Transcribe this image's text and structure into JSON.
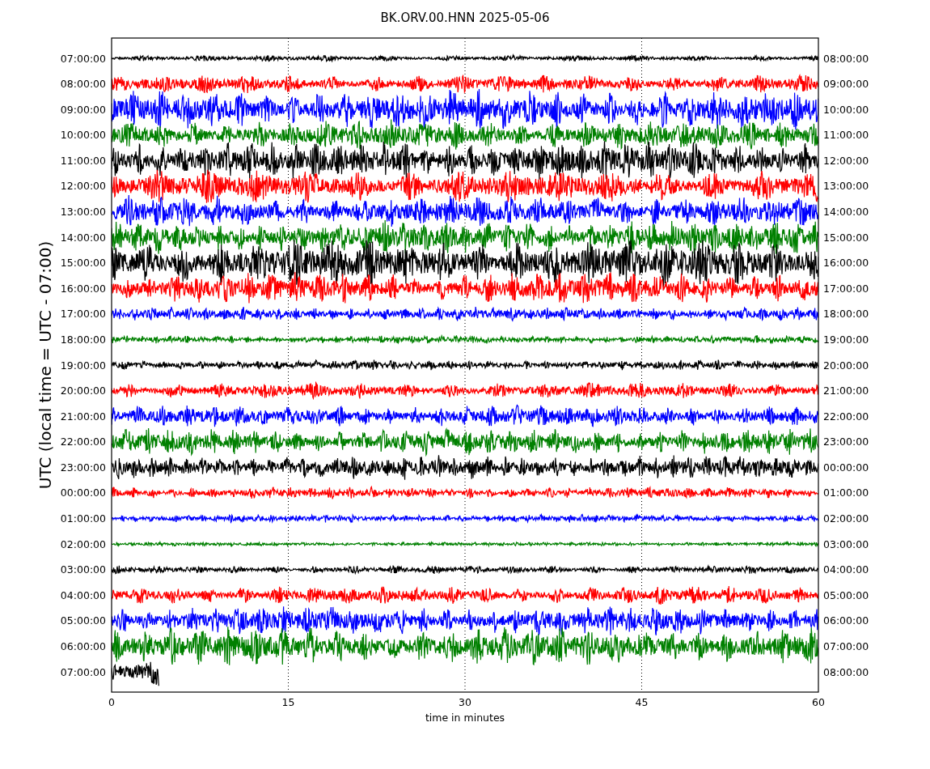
{
  "title": "BK.ORV.00.HNN 2025-05-06",
  "y_axis_label": "UTC (local time = UTC - 07:00)",
  "x_axis_label": "time in minutes",
  "x_ticks": [
    "0",
    "15",
    "30",
    "45",
    "60"
  ],
  "traces": [
    {
      "left_label": "07:00:00",
      "right_label": "08:00:00",
      "color": "#000000"
    },
    {
      "left_label": "08:00:00",
      "right_label": "09:00:00",
      "color": "#ff0000"
    },
    {
      "left_label": "09:00:00",
      "right_label": "10:00:00",
      "color": "#0000ff"
    },
    {
      "left_label": "10:00:00",
      "right_label": "11:00:00",
      "color": "#008000"
    },
    {
      "left_label": "11:00:00",
      "right_label": "12:00:00",
      "color": "#000000"
    },
    {
      "left_label": "12:00:00",
      "right_label": "13:00:00",
      "color": "#ff0000"
    },
    {
      "left_label": "13:00:00",
      "right_label": "14:00:00",
      "color": "#0000ff"
    },
    {
      "left_label": "14:00:00",
      "right_label": "15:00:00",
      "color": "#008000"
    },
    {
      "left_label": "15:00:00",
      "right_label": "16:00:00",
      "color": "#000000"
    },
    {
      "left_label": "16:00:00",
      "right_label": "17:00:00",
      "color": "#ff0000"
    },
    {
      "left_label": "17:00:00",
      "right_label": "18:00:00",
      "color": "#0000ff"
    },
    {
      "left_label": "18:00:00",
      "right_label": "19:00:00",
      "color": "#008000"
    },
    {
      "left_label": "19:00:00",
      "right_label": "20:00:00",
      "color": "#000000"
    },
    {
      "left_label": "20:00:00",
      "right_label": "21:00:00",
      "color": "#ff0000"
    },
    {
      "left_label": "21:00:00",
      "right_label": "22:00:00",
      "color": "#0000ff"
    },
    {
      "left_label": "22:00:00",
      "right_label": "23:00:00",
      "color": "#008000"
    },
    {
      "left_label": "23:00:00",
      "right_label": "00:00:00",
      "color": "#000000"
    },
    {
      "left_label": "00:00:00",
      "right_label": "01:00:00",
      "color": "#ff0000"
    },
    {
      "left_label": "01:00:00",
      "right_label": "02:00:00",
      "color": "#0000ff"
    },
    {
      "left_label": "02:00:00",
      "right_label": "03:00:00",
      "color": "#008000"
    },
    {
      "left_label": "03:00:00",
      "right_label": "04:00:00",
      "color": "#000000"
    },
    {
      "left_label": "04:00:00",
      "right_label": "05:00:00",
      "color": "#ff0000"
    },
    {
      "left_label": "05:00:00",
      "right_label": "06:00:00",
      "color": "#0000ff"
    },
    {
      "left_label": "06:00:00",
      "right_label": "07:00:00",
      "color": "#008000"
    },
    {
      "left_label": "07:00:00",
      "right_label": "08:00:00",
      "color": "#000000"
    }
  ]
}
